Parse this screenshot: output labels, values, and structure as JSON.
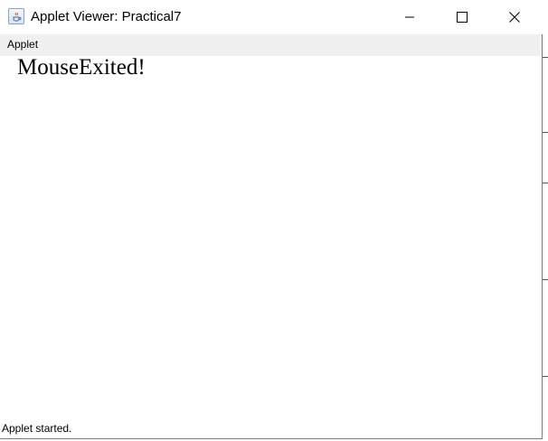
{
  "window": {
    "title": "Applet Viewer: Practical7"
  },
  "menubar": {
    "items": [
      {
        "label": "Applet"
      }
    ]
  },
  "canvas": {
    "message": "MouseExited!"
  },
  "status": {
    "text": "Applet started."
  },
  "icons": {
    "app": "java-applet-icon",
    "minimize": "minimize-icon",
    "maximize": "maximize-icon",
    "close": "close-icon"
  }
}
